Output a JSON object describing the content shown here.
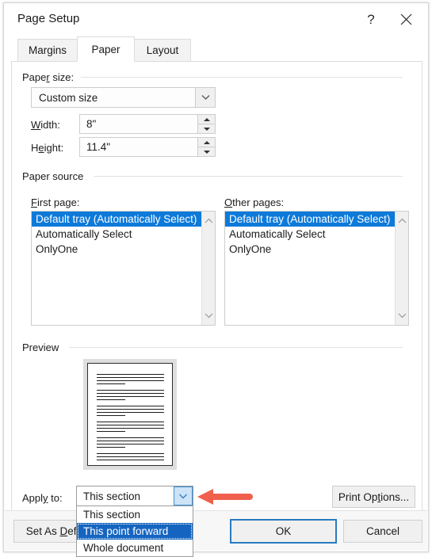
{
  "window": {
    "title": "Page Setup",
    "help_icon": "question-mark-icon",
    "help_label": "?",
    "close_icon": "close-icon"
  },
  "tabs": [
    {
      "label": "Margins",
      "active": false
    },
    {
      "label": "Paper",
      "active": true
    },
    {
      "label": "Layout",
      "active": false
    }
  ],
  "paper_size": {
    "group_label_pre": "Pape",
    "group_label_key": "r",
    "group_label_post": " size:",
    "group_label_full": "Paper size:",
    "combo_value": "Custom size",
    "combo_icon": "chevron-down-icon",
    "width": {
      "label_pre": "",
      "label_key": "W",
      "label_post": "idth:",
      "label_full": "Width:",
      "value": "8\"",
      "up_icon": "spinner-up-icon",
      "down_icon": "spinner-down-icon"
    },
    "height": {
      "label_pre": "H",
      "label_key": "e",
      "label_post": "ight:",
      "label_full": "Height:",
      "value": "11.4\"",
      "up_icon": "spinner-up-icon",
      "down_icon": "spinner-down-icon"
    }
  },
  "paper_source": {
    "group_label": "Paper source",
    "first_page": {
      "label_pre": "",
      "label_key": "F",
      "label_post": "irst page:",
      "label_full": "First page:",
      "items": [
        {
          "label": "Default tray (Automatically Select)",
          "selected": true
        },
        {
          "label": "Automatically Select",
          "selected": false
        },
        {
          "label": "OnlyOne",
          "selected": false
        }
      ],
      "scroll_up_icon": "chevron-up-icon",
      "scroll_down_icon": "chevron-down-icon"
    },
    "other_pages": {
      "label_pre": "",
      "label_key": "O",
      "label_post": "ther pages:",
      "label_full": "Other pages:",
      "items": [
        {
          "label": "Default tray (Automatically Select)",
          "selected": true
        },
        {
          "label": "Automatically Select",
          "selected": false
        },
        {
          "label": "OnlyOne",
          "selected": false
        }
      ],
      "scroll_up_icon": "chevron-up-icon",
      "scroll_down_icon": "chevron-down-icon"
    }
  },
  "preview": {
    "group_label": "Preview",
    "page_icon": "document-page-preview",
    "paragraphs": [
      {
        "full_lines": 3,
        "short_line": true
      },
      {
        "full_lines": 3,
        "short_line": true
      },
      {
        "full_lines": 3,
        "short_line": true
      },
      {
        "full_lines": 3,
        "short_line": true
      },
      {
        "full_lines": 3,
        "short_line": true
      },
      {
        "full_lines": 3,
        "short_line": false
      }
    ]
  },
  "apply_to": {
    "label_pre": "Appl",
    "label_key": "y",
    "label_post": " to:",
    "label_full": "Apply to:",
    "selected_value": "This section",
    "arrow_icon": "chevron-down-icon",
    "expanded": true,
    "options": [
      {
        "label": "This section",
        "highlighted": false
      },
      {
        "label": "This point forward",
        "highlighted": true
      },
      {
        "label": "Whole document",
        "highlighted": false
      }
    ]
  },
  "buttons": {
    "print_options": {
      "label_pre": "Print Op",
      "label_key": "t",
      "label_post": "ions...",
      "label_full": "Print Options..."
    },
    "set_as_default": {
      "label_pre": "Set As ",
      "label_key": "D",
      "label_post": "efault",
      "label_full": "Set As Default"
    },
    "ok": {
      "label": "OK",
      "focused": true
    },
    "cancel": {
      "label": "Cancel",
      "focused": false
    }
  },
  "annotation": {
    "arrow_icon": "left-pointing-arrow-annotation",
    "color": "#f0604d",
    "points_to": "apply-to-dropdown-arrow"
  },
  "colors": {
    "selection_blue": "#0d7ada",
    "highlight_blue": "#1565c0",
    "focus_border": "#2a7bc0",
    "annotation_red": "#f0604d",
    "dialog_bg": "#ffffff",
    "footer_bg": "#f7f7f7",
    "control_bg": "#f0f0f0"
  }
}
